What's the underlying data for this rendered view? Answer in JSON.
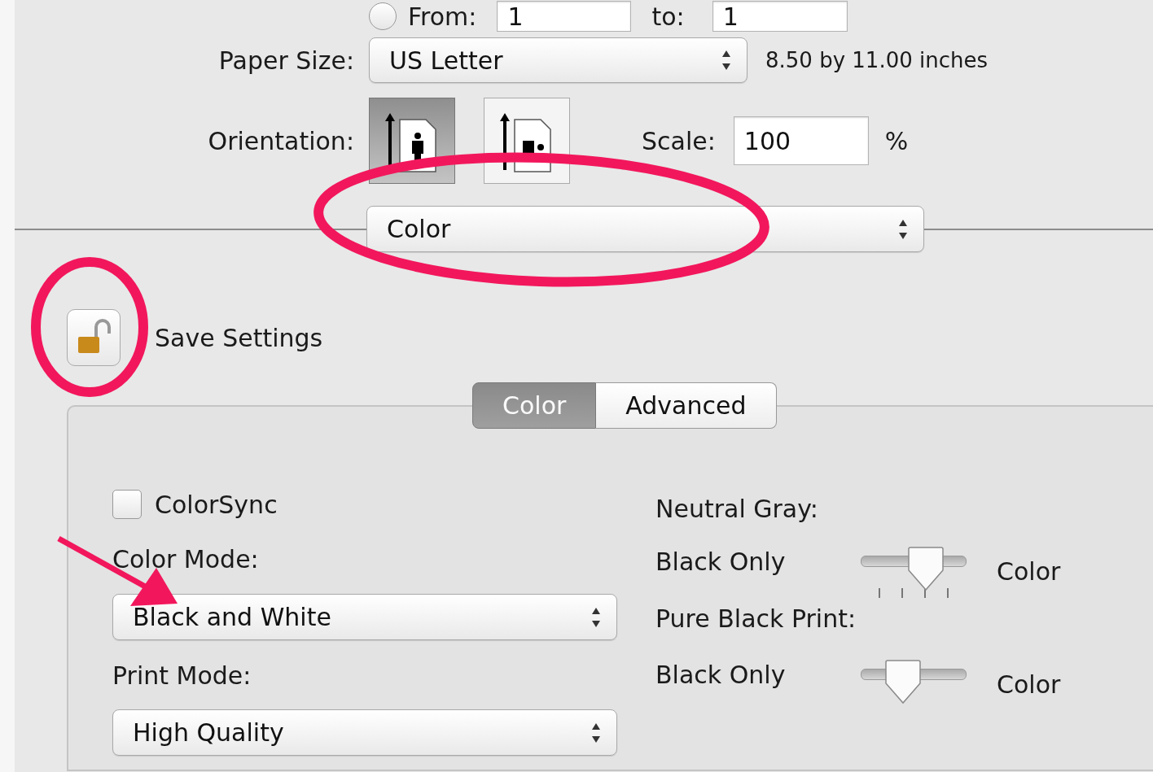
{
  "page_range": {
    "selected": false,
    "from_label": "From:",
    "from_value": "1",
    "to_label": "to:",
    "to_value": "1"
  },
  "paper_size": {
    "label": "Paper Size:",
    "value": "US Letter",
    "dimensions": "8.50 by 11.00 inches"
  },
  "orientation": {
    "label": "Orientation:",
    "options": [
      {
        "kind": "portrait",
        "selected": true
      },
      {
        "kind": "landscape",
        "selected": false
      }
    ]
  },
  "scale": {
    "label": "Scale:",
    "value": "100",
    "unit": "%"
  },
  "panel_menu": {
    "value": "Color"
  },
  "save_settings": {
    "label": "Save Settings",
    "locked": false
  },
  "tabs": [
    {
      "label": "Color",
      "selected": true
    },
    {
      "label": "Advanced",
      "selected": false
    }
  ],
  "colorsync": {
    "label": "ColorSync",
    "checked": false
  },
  "color_mode": {
    "label": "Color Mode:",
    "value": "Black and White"
  },
  "print_mode": {
    "label": "Print Mode:",
    "value": "High Quality"
  },
  "sliders": [
    {
      "label": "Neutral Gray:",
      "min_label": "Black Only",
      "max_label": "Color",
      "level": 0.67,
      "ticks": true
    },
    {
      "label": "Pure Black Print:",
      "min_label": "Black Only",
      "max_label": "Color",
      "level": 0.33,
      "ticks": false
    }
  ]
}
